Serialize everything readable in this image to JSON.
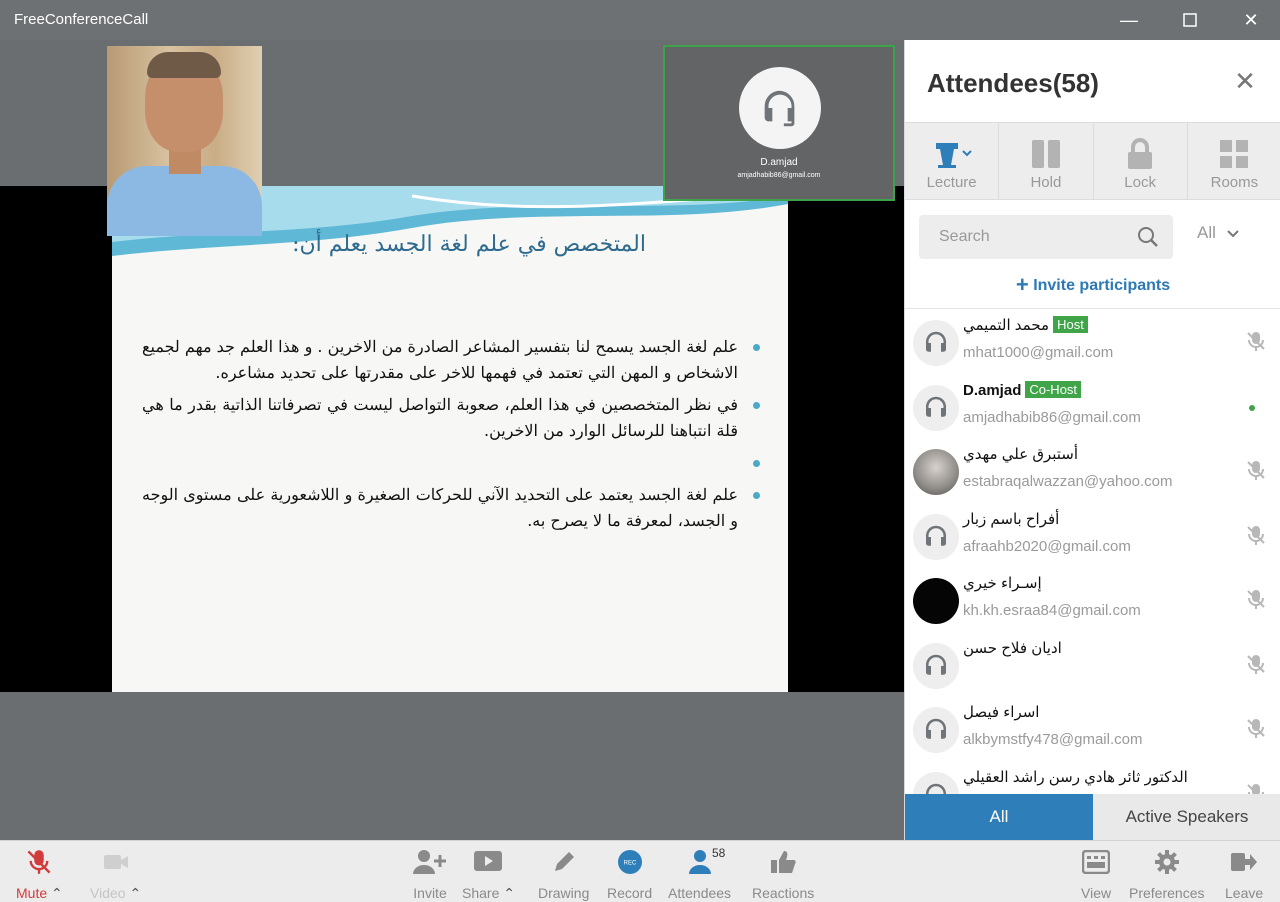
{
  "window": {
    "title": "FreeConferenceCall",
    "minimize": "—",
    "maximize": "☐",
    "close": "✕"
  },
  "stage": {
    "slide": {
      "title": "المتخصص في علم لغة الجسد يعلم أن:",
      "bullets": [
        "علم لغة الجسد يسمح لنا بتفسير المشاعر الصادرة من الاخرين . و هذا العلم جد مهم لجميع الاشخاص و المهن التي تعتمد في فهمها للاخر على مقدرتها على تحديد مشاعره.",
        "في نظر المتخصصين في هذا العلم، صعوبة التواصل ليست في تصرفاتنا الذاتية بقدر ما هي قلة انتباهنا للرسائل الوارد من الاخرين.",
        "",
        "علم لغة الجسد يعتمد على التحديد الآني للحركات الصغيرة و اللاشعورية على مستوى الوجه و الجسد، لمعرفة ما لا يصرح به."
      ]
    },
    "speaker_tile": {
      "name": "D.amjad",
      "email": "amjadhabib86@gmail.com"
    }
  },
  "panel": {
    "title": "Attendees(58)",
    "close": "✕",
    "tools": [
      "Lecture",
      "Hold",
      "Lock",
      "Rooms"
    ],
    "search_placeholder": "Search",
    "filter": "All",
    "invite": "Invite participants",
    "attendees": [
      {
        "name": "محمد التميمي",
        "badge": "Host",
        "email": "mhat1000@gmail.com"
      },
      {
        "name": "D.amjad",
        "badge": "Co-Host",
        "email": "amjadhabib86@gmail.com"
      },
      {
        "name": "أستبرق علي مهدي",
        "email": "estabraqalwazzan@yahoo.com"
      },
      {
        "name": "أفراح باسم زبار",
        "email": "afraahb2020@gmail.com"
      },
      {
        "name": "إسـراء خيري",
        "email": "kh.kh.esraa84@gmail.com"
      },
      {
        "name": "اديان فلاح حسن",
        "email": ""
      },
      {
        "name": "اسراء فيصل",
        "email": "alkbymstfy478@gmail.com"
      },
      {
        "name": "الدكتور ثائر هادي رسن راشد العقيلي",
        "email": ""
      }
    ],
    "tabs": [
      "All",
      "Active Speakers"
    ]
  },
  "toolbar": {
    "mute": "Mute",
    "video": "Video",
    "invite": "Invite",
    "share": "Share",
    "drawing": "Drawing",
    "record": "Record",
    "record_badge": "REC",
    "attendees": "Attendees",
    "attendees_count": "58",
    "reactions": "Reactions",
    "view": "View",
    "preferences": "Preferences",
    "leave": "Leave"
  },
  "colors": {
    "accent": "#2e7fb9",
    "host_badge": "#3fa548",
    "mute_red": "#d23b3b",
    "record_blue": "#2e7fb9"
  }
}
